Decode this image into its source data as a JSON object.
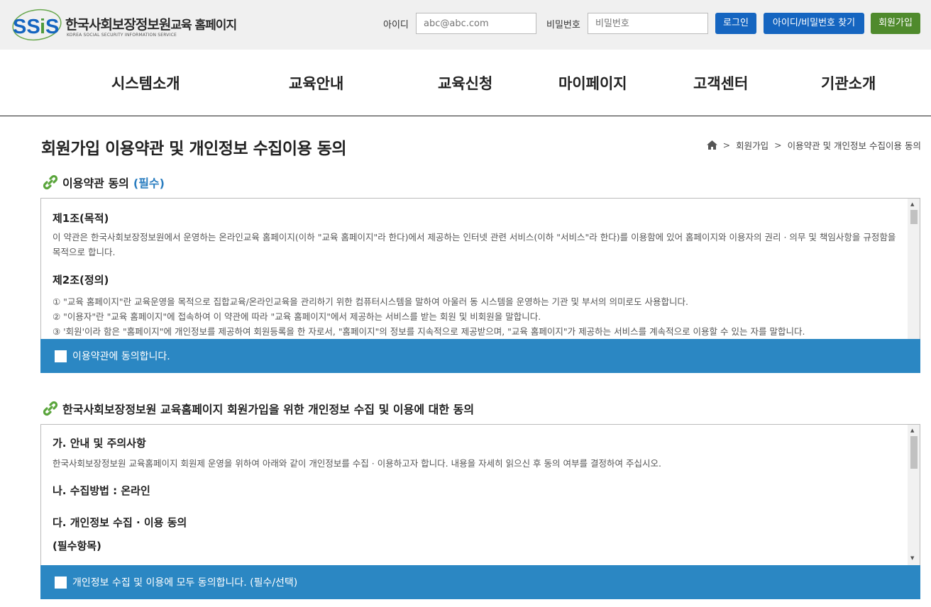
{
  "header": {
    "logo_mark": "SSiS",
    "logo_title": "한국사회보장정보원",
    "logo_title_suffix": "교육 홈페이지",
    "logo_sub": "KOREA SOCIAL SECURITY INFORMATION SERVICE",
    "id_label": "아이디",
    "id_placeholder": "abc@abc.com",
    "pw_label": "비밀번호",
    "pw_placeholder": "비밀번호",
    "login_button": "로그인",
    "find_button": "아이디/비밀번호 찾기",
    "join_button": "회원가입",
    "colors": {
      "blue_button": "#1565c0",
      "green_button": "#4f8a2c"
    }
  },
  "nav": {
    "items": [
      "시스템소개",
      "교육안내",
      "교육신청",
      "마이페이지",
      "고객센터",
      "기관소개"
    ]
  },
  "page": {
    "title": "회원가입 이용약관 및 개인정보 수집이용 동의",
    "breadcrumb": {
      "home_icon": "home-icon",
      "items": [
        "회원가입",
        "이용약관 및 개인정보 수집이용 동의"
      ]
    }
  },
  "terms": {
    "heading": "이용약관 동의",
    "required": "(필수)",
    "icon": "link-icon",
    "art1_title": "제1조(목적)",
    "art1_text": "이 약관은 한국사회보장정보원에서 운영하는 온라인교육 홈페이지(이하 \"교육 홈페이지\"라 한다)에서 제공하는 인터넷 관련 서비스(이하 \"서비스\"라 한다)를 이용함에 있어 홈페이지와 이용자의 권리 · 의무 및 책임사항을 규정함을 목적으로 합니다.",
    "art2_title": "제2조(정의)",
    "art2_items": [
      "① \"교육 홈페이지\"란 교육운영을 목적으로 집합교육/온라인교육을 관리하기 위한 컴퓨터시스템을 말하여 아울러 동 시스템을 운영하는 기관 및 부서의 의미로도 사용합니다.",
      "② \"이용자\"란 \"교육 홈페이지\"에 접속하여 이 약관에 따라 \"교육 홈페이지\"에서 제공하는 서비스를 받는 회원 및 비회원을 말합니다.",
      "③ '회원'이라 함은 \"홈페이지\"에 개인정보를 제공하여 회원등록을 한 자로서, \"홈페이지\"의 정보를 지속적으로 제공받으며, \"교육 홈페이지\"가 제공하는 서비스를 계속적으로 이용할 수 있는 자를 말합니다."
    ],
    "agree_label": "이용약관에 동의합니다."
  },
  "privacy": {
    "heading": "한국사회보장정보원 교육홈페이지 회원가입을 위한 개인정보 수집 및 이용에 대한 동의",
    "icon": "link-icon",
    "sec1_title": "가. 안내 및 주의사항",
    "sec1_text": "한국사회보장정보원 교육홈페이지 회원제 운영을 위하여 아래와 같이 개인정보를 수집 · 이용하고자 합니다. 내용을 자세히 읽으신 후 동의 여부를 결정하여 주십시오.",
    "sec2_title": "나. 수집방법 : 온라인",
    "sec3_title": "다. 개인정보 수집 · 이용 동의",
    "sec3_sub": "(필수항목)",
    "agree_label": "개인정보 수집 및 이용에 모두 동의합니다. (필수/선택)"
  },
  "colors": {
    "agree_bar": "#2b87c3",
    "required_text": "#2a7dc0",
    "icon_green": "#5aa53c"
  }
}
